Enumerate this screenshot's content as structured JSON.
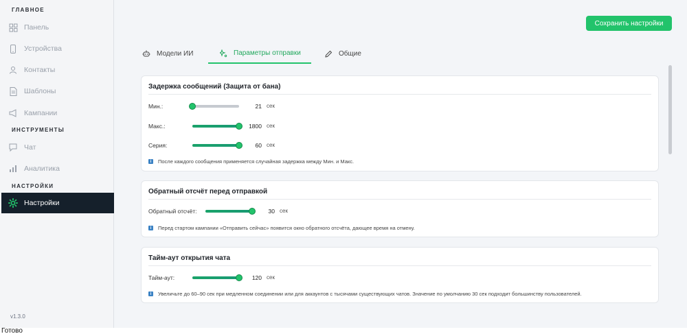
{
  "sidebar": {
    "section_main": "ГЛАВНОЕ",
    "section_tools": "ИНСТРУМЕНТЫ",
    "section_settings": "НАСТРОЙКИ",
    "items": {
      "panel": "Панель",
      "devices": "Устройства",
      "contacts": "Контакты",
      "templates": "Шаблоны",
      "campaigns": "Кампании",
      "chat": "Чат",
      "analytics": "Аналитика",
      "settings": "Настройки"
    },
    "version": "v1.3.0"
  },
  "header": {
    "save_label": "Сохранить настройки"
  },
  "tabs": {
    "ai_models": "Модели ИИ",
    "send_params": "Параметры отправки",
    "general": "Общие"
  },
  "delay_card": {
    "title": "Задержка сообщений  (Защита от бана)",
    "min": {
      "label": "Мин.:",
      "value": "21",
      "unit": "сек",
      "level": 0.0
    },
    "max": {
      "label": "Макс.:",
      "value": "1800",
      "unit": "сек",
      "level": 1.0
    },
    "series": {
      "label": "Серия:",
      "value": "60",
      "unit": "сек",
      "level": 1.0
    },
    "info": "После каждого сообщения применяется случайная задержка между Мин. и Макс."
  },
  "countdown_card": {
    "title": "Обратный отсчёт перед отправкой",
    "row": {
      "label": "Обратный отсчёт:",
      "value": "30",
      "unit": "сек",
      "level": 1.0
    },
    "info": "Перед стартом кампании «Отправить сейчас» появится окно обратного отсчёта, дающее время на отмену."
  },
  "timeout_card": {
    "title": "Тайм-аут открытия чата",
    "row": {
      "label": "Тайм-аут:",
      "value": "120",
      "unit": "сек",
      "level": 1.0
    },
    "info": "Увеличьте до 60–90 сек при медленном соединении или для аккаунтов с тысячами существующих чатов. Значение по умолчанию 30 сек подходит большинству пользователей."
  },
  "status": {
    "text": "Готово"
  },
  "colors": {
    "accent": "#22c36b",
    "sidebar_active": "#15202b",
    "info_icon": "#3b82c4"
  }
}
